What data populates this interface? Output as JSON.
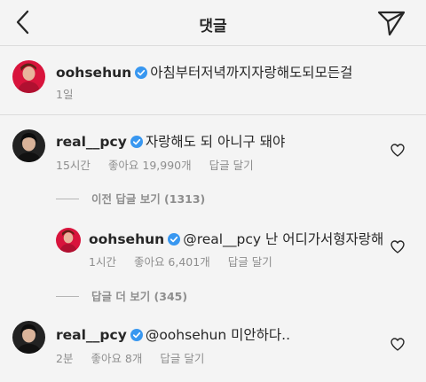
{
  "header": {
    "title": "댓글"
  },
  "caption": {
    "username": "oohsehun",
    "text": "아침부터저녁까지자랑해도되모든걸",
    "time": "1일"
  },
  "comments": [
    {
      "username": "real__pcy",
      "text": "자랑해도 되 아니구 돼야",
      "time": "15시간",
      "likes": "좋아요 19,990개",
      "reply_label": "답글 달기"
    },
    {
      "username": "oohsehun",
      "text": "@real__pcy 난 어디가서형자랑해",
      "time": "1시간",
      "likes": "좋아요 6,401개",
      "reply_label": "답글 달기"
    },
    {
      "username": "real__pcy",
      "text": "@oohsehun 미안하다..",
      "time": "2분",
      "likes": "좋아요 8개",
      "reply_label": "답글 달기"
    }
  ],
  "view_prev": "이전 답글 보기 (1313)",
  "view_more": "답글 더 보기 (345)",
  "colors": {
    "verified": "#3897f0",
    "sehun_bg": "#d8143c",
    "pcy_bg": "#222222"
  },
  "icons": [
    "back-arrow-icon",
    "send-icon",
    "verified-icon",
    "heart-icon"
  ]
}
